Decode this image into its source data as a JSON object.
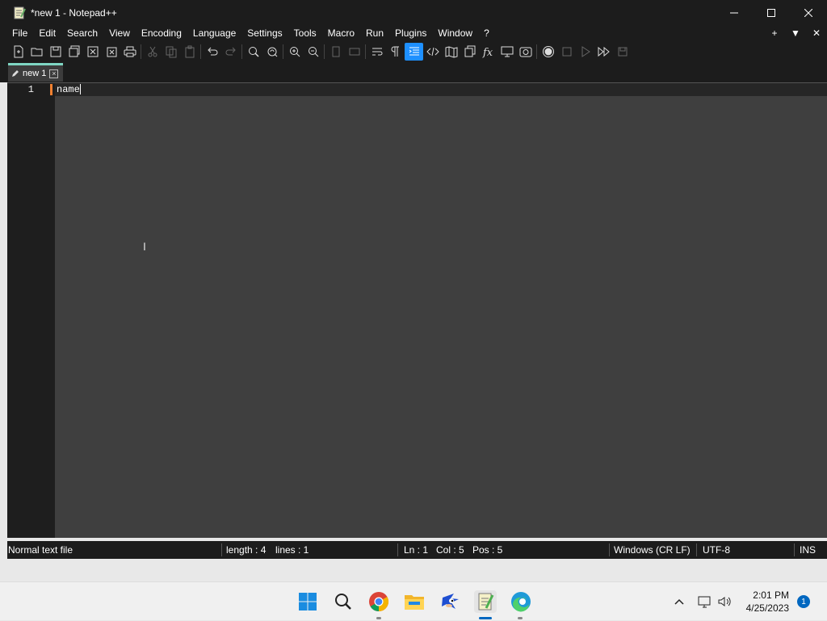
{
  "window": {
    "title": "*new 1 - Notepad++"
  },
  "menu": {
    "items": [
      "File",
      "Edit",
      "Search",
      "View",
      "Encoding",
      "Language",
      "Settings",
      "Tools",
      "Macro",
      "Run",
      "Plugins",
      "Window",
      "?"
    ],
    "right": [
      "+",
      "▼",
      "✕"
    ]
  },
  "toolbar": {
    "icons": [
      "new-file",
      "open-file",
      "save",
      "save-all",
      "close",
      "close-all",
      "print",
      "cut",
      "copy",
      "paste",
      "undo",
      "redo",
      "find",
      "replace",
      "zoom-in",
      "zoom-out",
      "sync-vertical",
      "sync-horizontal",
      "word-wrap",
      "show-all-chars",
      "indent-guide",
      "html-tag",
      "document-map",
      "document-list",
      "function-list",
      "monitor",
      "record-macro",
      "stop-macro",
      "play-macro",
      "run-macro-multiple",
      "save-macro"
    ]
  },
  "tab": {
    "label": "new 1"
  },
  "editor": {
    "line_number": "1",
    "text": "name"
  },
  "status": {
    "file_type": "Normal text file",
    "length": "length : 4",
    "lines": "lines : 1",
    "ln": "Ln : 1",
    "col": "Col : 5",
    "pos": "Pos : 5",
    "eol": "Windows (CR LF)",
    "encoding": "UTF-8",
    "mode": "INS"
  },
  "taskbar": {
    "time": "2:01 PM",
    "date": "4/25/2023",
    "notification_count": "1"
  },
  "colors": {
    "accent": "#1e90ff",
    "tab_accent": "#7fd6c4",
    "fold_marker": "#f08030"
  }
}
